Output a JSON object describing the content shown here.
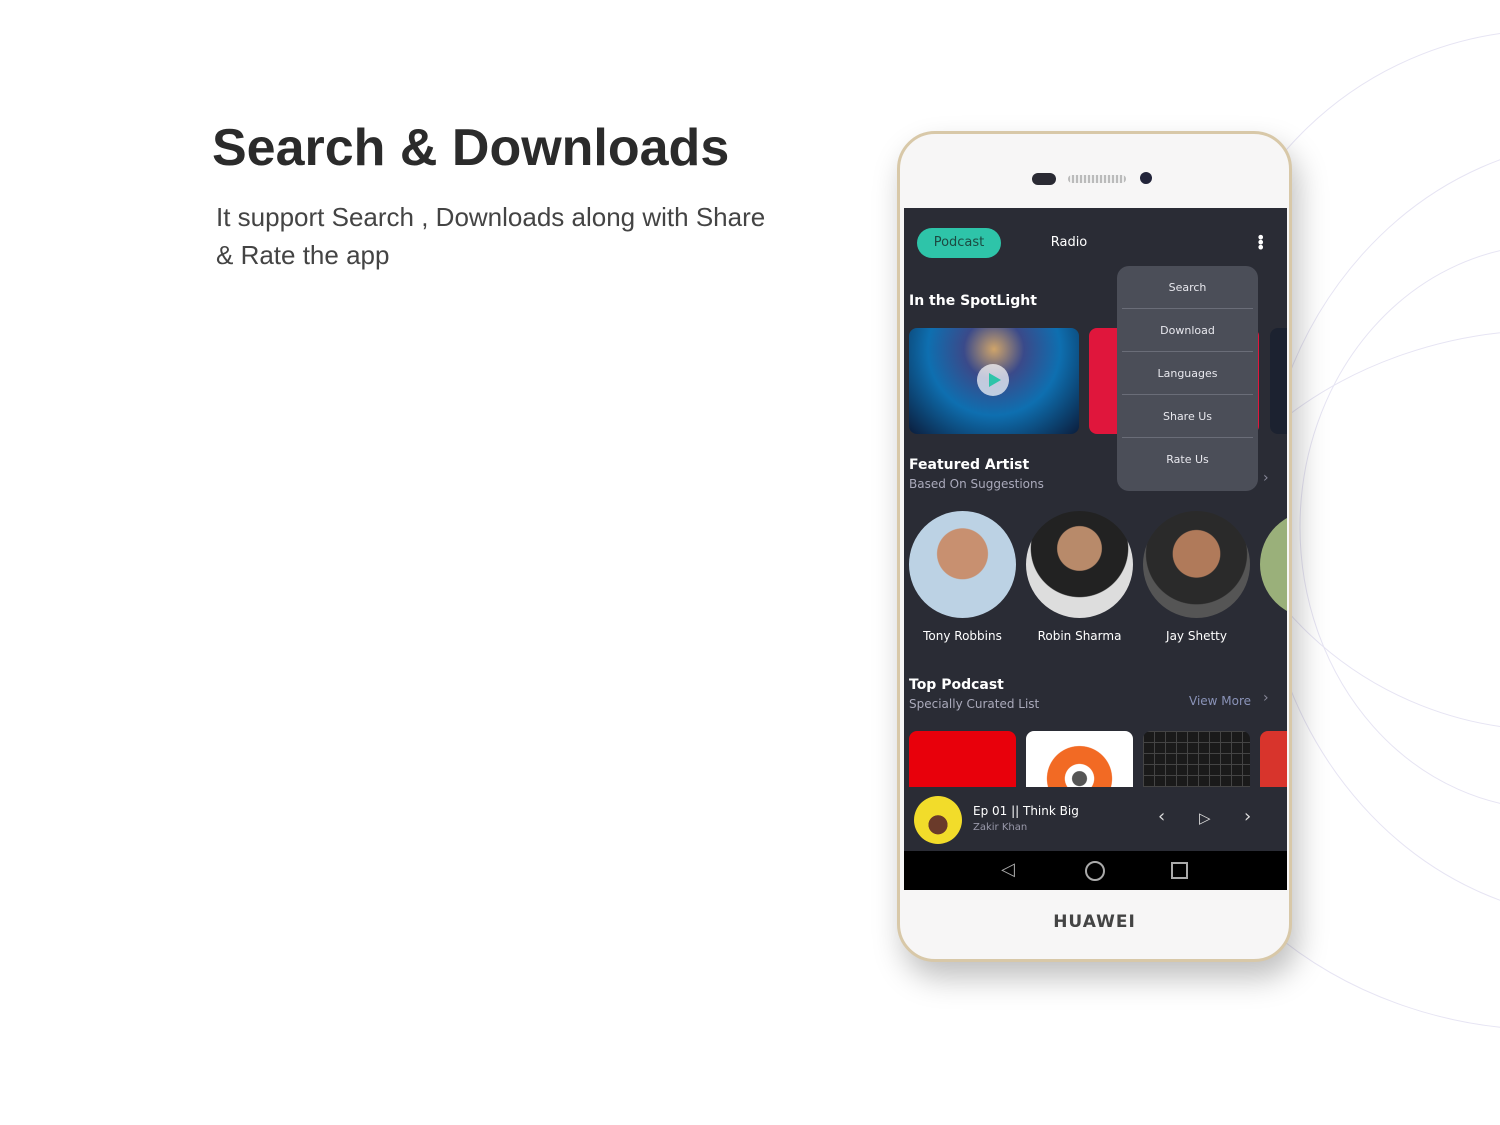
{
  "hero": {
    "title": "Search & Downloads",
    "subtitle": "It support Search , Downloads along with Share & Rate the app"
  },
  "device": {
    "brand": "HUAWEI"
  },
  "app": {
    "tabs": [
      {
        "label": "Podcast",
        "active": true
      },
      {
        "label": "Radio",
        "active": false
      }
    ],
    "menu": [
      "Search",
      "Download",
      "Languages",
      "Share Us",
      "Rate Us"
    ],
    "spotlight": {
      "title": "In the SpotLight"
    },
    "featured": {
      "title": "Featured Artist",
      "subtitle": "Based On Suggestions",
      "artists": [
        "Tony Robbins",
        "Robin Sharma",
        "Jay Shetty"
      ]
    },
    "top_podcast": {
      "title": "Top Podcast",
      "subtitle": "Specially Curated List",
      "view_more": "View More"
    },
    "player": {
      "episode": "Ep 01 || Think Big",
      "artist": "Zakir Khan"
    }
  },
  "colors": {
    "accent": "#2ec4a9",
    "background": "#2a2c35",
    "menu": "#4b4e58"
  }
}
